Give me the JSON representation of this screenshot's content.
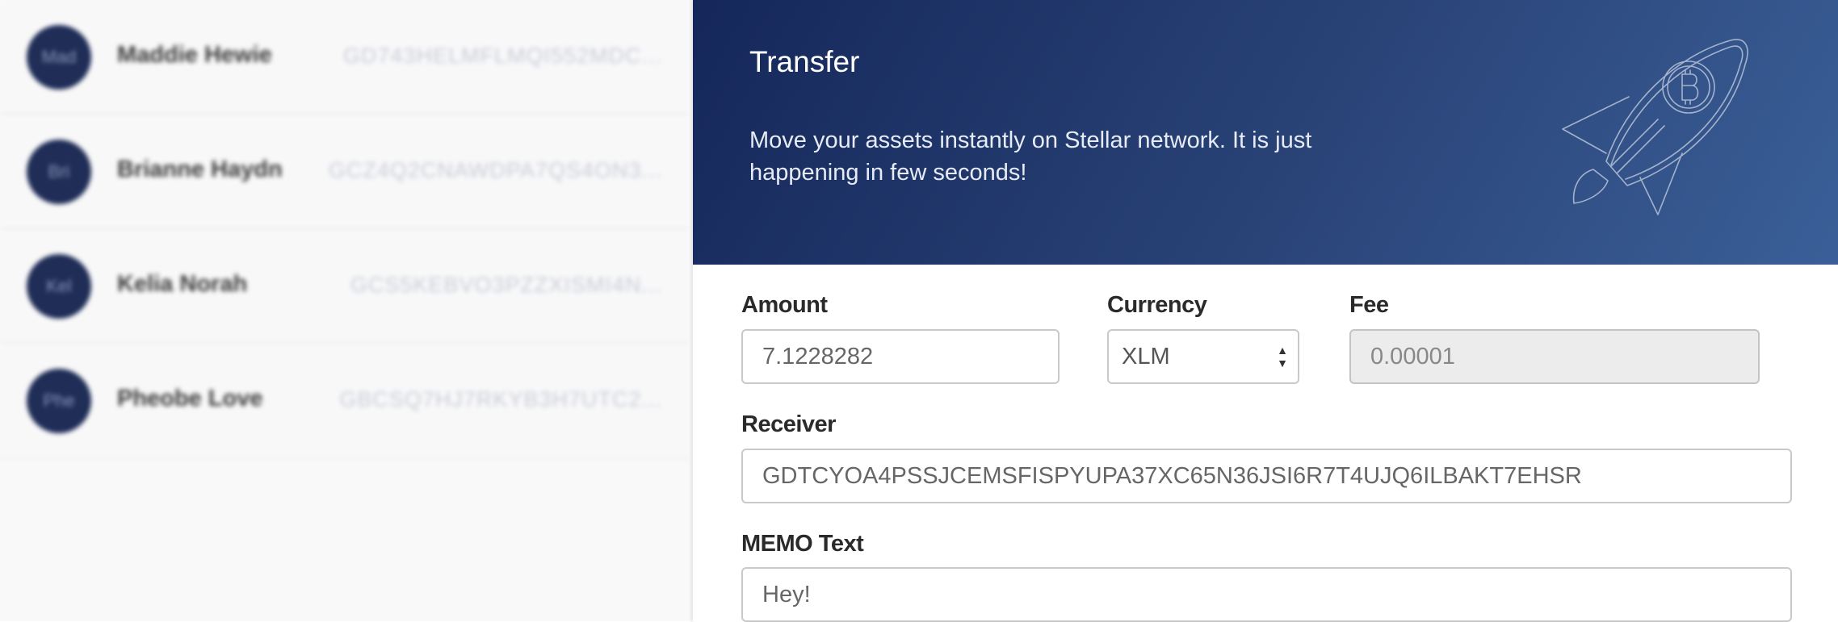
{
  "contacts": [
    {
      "initials": "Mad",
      "name": "Maddie Hewie",
      "address": "GD743HELMFLMQI552MDC..."
    },
    {
      "initials": "Bri",
      "name": "Brianne Haydn",
      "address": "GCZ4Q2CNAWDPA7QS4ON3..."
    },
    {
      "initials": "Kel",
      "name": "Kelia Norah",
      "address": "GCS5KEBVO3PZZXISMI4N..."
    },
    {
      "initials": "Phe",
      "name": "Pheobe Love",
      "address": "GBCSQ7HJ7RKYB3H7UTC2..."
    }
  ],
  "header": {
    "title": "Transfer",
    "description": "Move your assets instantly on Stellar network. It is just happening in few seconds!",
    "illustration": "rocket-bitcoin-icon"
  },
  "form": {
    "amount": {
      "label": "Amount",
      "value": "7.1228282"
    },
    "currency": {
      "label": "Currency",
      "selected": "XLM"
    },
    "fee": {
      "label": "Fee",
      "value": "0.00001"
    },
    "receiver": {
      "label": "Receiver",
      "value": "GDTCYOA4PSSJCEMSFISPYUPA37XC65N36JSI6R7T4UJQ6ILBAKT7EHSR"
    },
    "memo": {
      "label": "MEMO Text",
      "value": "Hey!"
    }
  },
  "colors": {
    "header_gradient_start": "#15275a",
    "header_gradient_end": "#3a5f98",
    "avatar": "#1f2d57"
  }
}
